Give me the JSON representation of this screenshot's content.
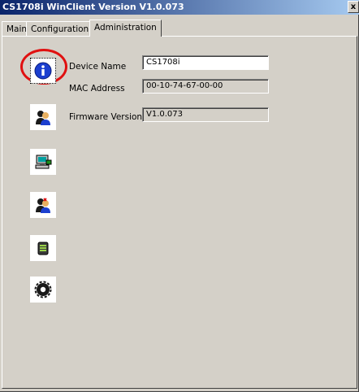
{
  "window": {
    "title": "CS1708i WinClient Version V1.0.073",
    "close_label": "x"
  },
  "tabs": [
    {
      "label": "Main"
    },
    {
      "label": "Configuration"
    },
    {
      "label": "Administration",
      "active": true
    }
  ],
  "sidebar_icons": [
    {
      "icon": "info-icon",
      "selected": true
    },
    {
      "icon": "user-admin-icon"
    },
    {
      "icon": "network-computer-icon"
    },
    {
      "icon": "user-security-icon"
    },
    {
      "icon": "firmware-icon"
    },
    {
      "icon": "settings-icon"
    }
  ],
  "device_info": {
    "device_name_label": "Device Name",
    "device_name_value": "CS1708i",
    "mac_label": "MAC Address",
    "mac_value": "00-10-74-67-00-00",
    "firmware_label": "Firmware Version",
    "firmware_value": "V1.0.073"
  },
  "colors": {
    "title_start": "#0a246a",
    "title_end": "#a6caf0",
    "highlight": "#e01010",
    "face": "#d4d0c8"
  }
}
